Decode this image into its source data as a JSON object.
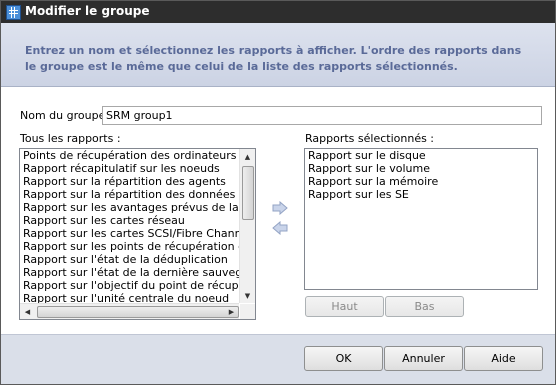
{
  "window": {
    "title": "Modifier le groupe"
  },
  "instructions": "Entrez un nom et sélectionnez les rapports à afficher. L'ordre des rapports dans le groupe est le même que celui de la liste des rapports sélectionnés.",
  "group_name": {
    "label": "Nom du groupe :",
    "value": "SRM group1"
  },
  "all_reports": {
    "label": "Tous les rapports :",
    "items": [
      "Points de récupération des ordinateurs virtuels",
      "Rapport récapitulatif sur les noeuds",
      "Rapport sur la répartition des agents",
      "Rapport sur la répartition des données sur les supports",
      "Rapport sur les avantages prévus de la déduplication",
      "Rapport sur les cartes réseau",
      "Rapport sur les cartes SCSI/Fibre Channel",
      "Rapport sur les points de récupération des noeuds",
      "Rapport sur l'état de la déduplication",
      "Rapport sur l'état de la dernière sauvegarde par noeud",
      "Rapport sur l'objectif du point de récupération",
      "Rapport sur l'unité centrale du noeud"
    ]
  },
  "selected_reports": {
    "label": "Rapports sélectionnés :",
    "items": [
      "Rapport sur le disque",
      "Rapport sur le volume",
      "Rapport sur la mémoire",
      "Rapport sur les SE"
    ]
  },
  "buttons": {
    "up": "Haut",
    "down": "Bas",
    "ok": "OK",
    "cancel": "Annuler",
    "help": "Aide"
  },
  "icons": {
    "add": "arrow-right-icon",
    "remove": "arrow-left-icon"
  },
  "colors": {
    "instruction_text": "#5a6a98",
    "banner": "#d3d9e8",
    "footer": "#dadfe9",
    "titlebar": "#2d2d2d"
  }
}
